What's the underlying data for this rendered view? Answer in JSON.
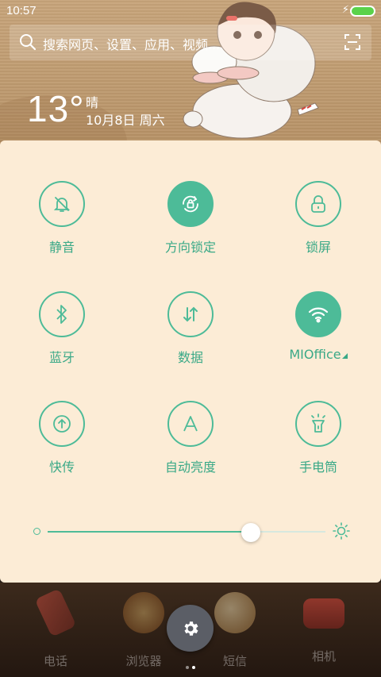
{
  "status": {
    "time": "10:57",
    "charging": true,
    "battery_color": "#5ad24a"
  },
  "search": {
    "placeholder": "搜索网页、设置、应用、视频..."
  },
  "weather": {
    "temperature": "13°",
    "condition": "晴",
    "date": "10月8日 周六"
  },
  "accent": "#4dbb98",
  "tiles": [
    {
      "label": "静音",
      "icon": "bell-off-icon",
      "active": false
    },
    {
      "label": "方向锁定",
      "icon": "rotation-lock-icon",
      "active": true
    },
    {
      "label": "锁屏",
      "icon": "lock-icon",
      "active": false
    },
    {
      "label": "蓝牙",
      "icon": "bluetooth-icon",
      "active": false
    },
    {
      "label": "数据",
      "icon": "data-arrows-icon",
      "active": false
    },
    {
      "label": "MIOffice",
      "icon": "wifi-icon",
      "active": true
    },
    {
      "label": "快传",
      "icon": "share-upload-icon",
      "active": false
    },
    {
      "label": "自动亮度",
      "icon": "auto-brightness-icon",
      "active": false
    },
    {
      "label": "手电筒",
      "icon": "flashlight-icon",
      "active": false
    }
  ],
  "brightness": {
    "level": 0.73
  },
  "dock": {
    "apps": [
      "电话",
      "浏览器",
      "短信",
      "相机"
    ],
    "settings_icon": "gear-icon",
    "page_count": 2,
    "active_page": 1
  }
}
